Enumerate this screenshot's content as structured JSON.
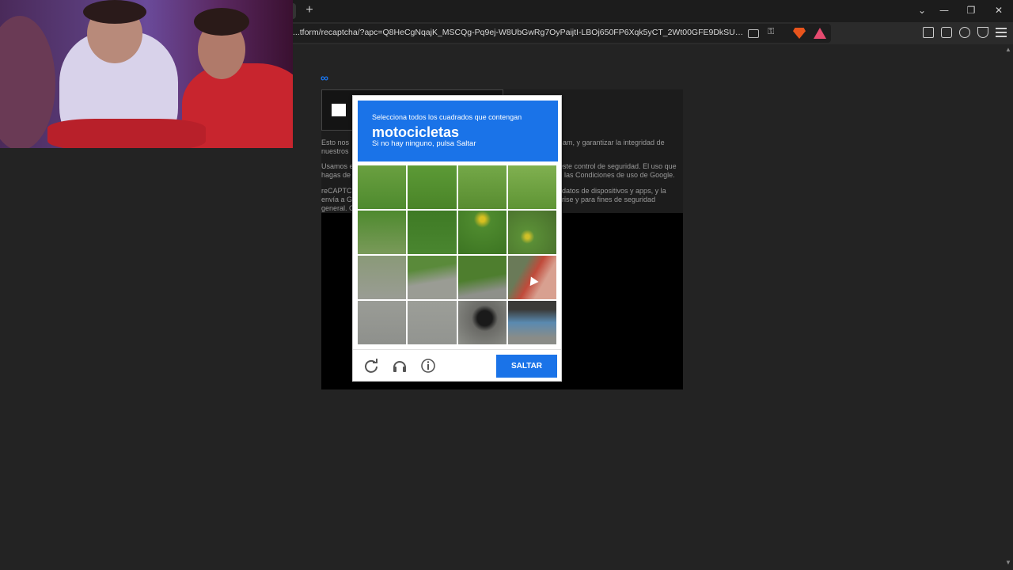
{
  "browser": {
    "url": "...tform/recaptcha/?apc=Q8HeCgNqajK_MSCQg-Pq9ej-W8UbGwRg7OyPaijtI-LBOj650FP6Xqk5yCT_2Wt00GFE9DkSUG2h...",
    "new_tab_label": "+",
    "colors": {
      "accent": "#1a73e8",
      "brave": "#e8541c",
      "meta": "#1a77f2"
    }
  },
  "background_page": {
    "logo": "∞",
    "para1_left": "Esto nos",
    "para1_left2": "nuestros",
    "para1_right": "am, y garantizar la integridad de",
    "para2_left": "Usamos e",
    "para2_left2": "hagas de",
    "para2_right": "este control de seguridad. El uso que",
    "para2_right2": "las Condiciones de uso de Google.",
    "para3_left": "reCAPTC",
    "para3_left2": "envía a G",
    "para3_left3": "general. C",
    "para3_right": "datos de dispositivos y apps, y la",
    "para3_right2": "rise y para fines de seguridad"
  },
  "captcha": {
    "instruction": "Selecciona todos los cuadrados que contengan",
    "target": "motocicletas",
    "subtext": "Si no hay ninguno, pulsa Saltar",
    "skip_label": "SALTAR",
    "footer_icons": [
      "reload-icon",
      "audio-icon",
      "info-icon"
    ],
    "grid_size": 4
  }
}
